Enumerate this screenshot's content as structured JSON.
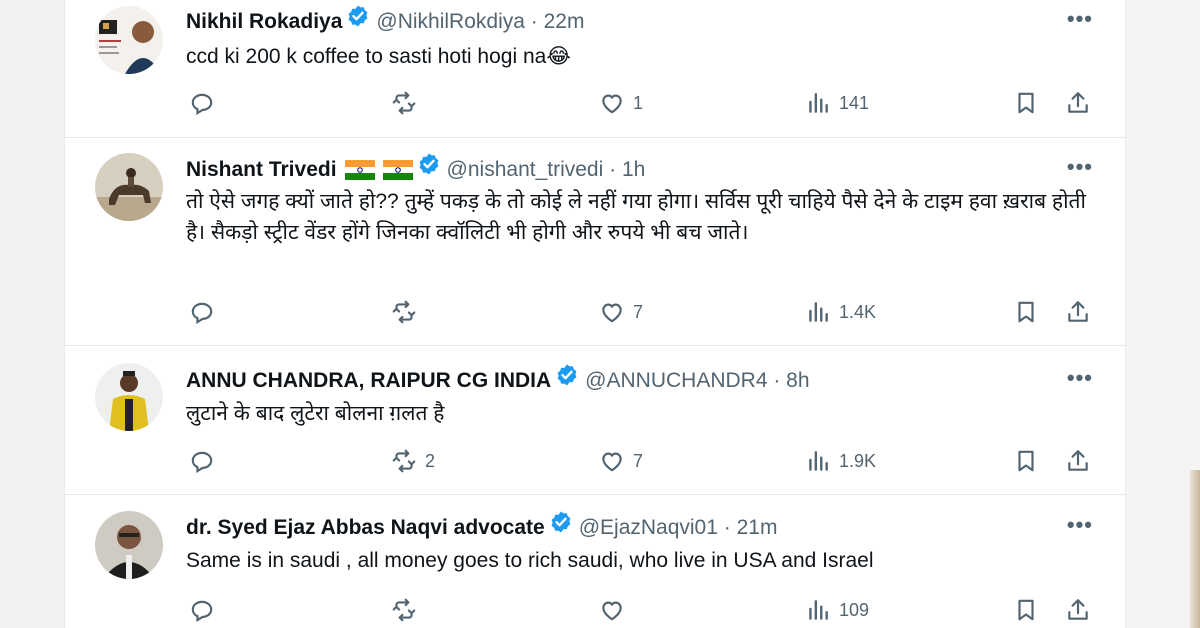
{
  "tweets": [
    {
      "name": "Nikhil Rokadiya",
      "flags": [],
      "meta": "@NikhilRokdiya · 22m",
      "text": "ccd ki 200 k coffee to sasti hoti hogi na😂",
      "replies": "",
      "retweets": "",
      "likes": "1",
      "views": "141"
    },
    {
      "name": "Nishant Trivedi",
      "flags": [
        "india-flag-icon",
        "india-flag-icon"
      ],
      "meta": "@nishant_trivedi · 1h",
      "text": "तो ऐसे जगह क्यों जाते हो?? तुम्हें पकड़ के तो कोई ले नहीं गया होगा। सर्विस पूरी चाहिये पैसे देने के टाइम हवा ख़राब होती है। सैकड़ो स्ट्रीट वेंडर होंगे जिनका क्वॉलिटी भी होगी और रुपये भी बच जाते।",
      "replies": "",
      "retweets": "",
      "likes": "7",
      "views": "1.4K"
    },
    {
      "name": "ANNU CHANDRA, RAIPUR CG INDIA",
      "flags": [],
      "meta": "@ANNUCHANDR4 · 8h",
      "text": "लुटाने के बाद लुटेरा बोलना ग़लत है",
      "replies": "",
      "retweets": "2",
      "likes": "7",
      "views": "1.9K"
    },
    {
      "name": "dr. Syed Ejaz Abbas Naqvi advocate",
      "flags": [],
      "meta": "@EjazNaqvi01 · 21m",
      "text": "Same is in saudi , all money goes to rich saudi, who live in USA and Israel",
      "replies": "",
      "retweets": "",
      "likes": "",
      "views": "109"
    }
  ],
  "icons": {
    "verified": "verified-badge-icon",
    "more": "more-icon",
    "reply": "reply-icon",
    "retweet": "retweet-icon",
    "like": "like-icon",
    "views": "views-icon",
    "bookmark": "bookmark-icon",
    "share": "share-icon"
  },
  "colors": {
    "verified": "#1d9bf0",
    "text": "#0f1419",
    "muted": "#536471"
  }
}
